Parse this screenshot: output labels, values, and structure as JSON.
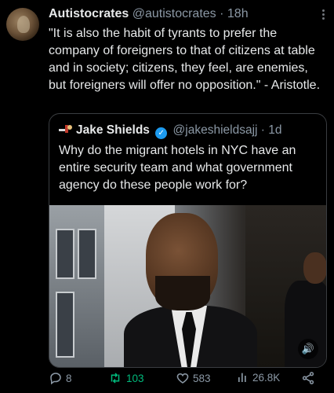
{
  "tweet": {
    "author_name": "Autistocrates",
    "author_handle": "@autistocrates",
    "separator": "·",
    "time": "18h",
    "text": "\"It is also the habit of tyrants to prefer the company of foreigners to that of citizens at table and in society; citizens, they feel, are enemies, but foreigners will offer no opposition.\" - Aristotle."
  },
  "quote": {
    "author_name": "Jake Shields",
    "author_handle": "@jakeshieldsajj",
    "separator": "·",
    "time": "1d",
    "text": "Why do the migrant hotels in NYC have an entire security team and what government agency do these people work for?"
  },
  "actions": {
    "replies": "8",
    "retweets": "103",
    "likes": "583",
    "views": "26.8K"
  },
  "colors": {
    "background": "#000000",
    "text": "#e7e9ea",
    "muted": "#8b98a5",
    "verified": "#1d9bf0",
    "retweet_active": "#00ba7c"
  },
  "icons": [
    "more-icon",
    "quote-author-icon",
    "verified-icon",
    "sound-icon",
    "reply-icon",
    "retweet-icon",
    "like-icon",
    "views-icon",
    "share-icon"
  ]
}
